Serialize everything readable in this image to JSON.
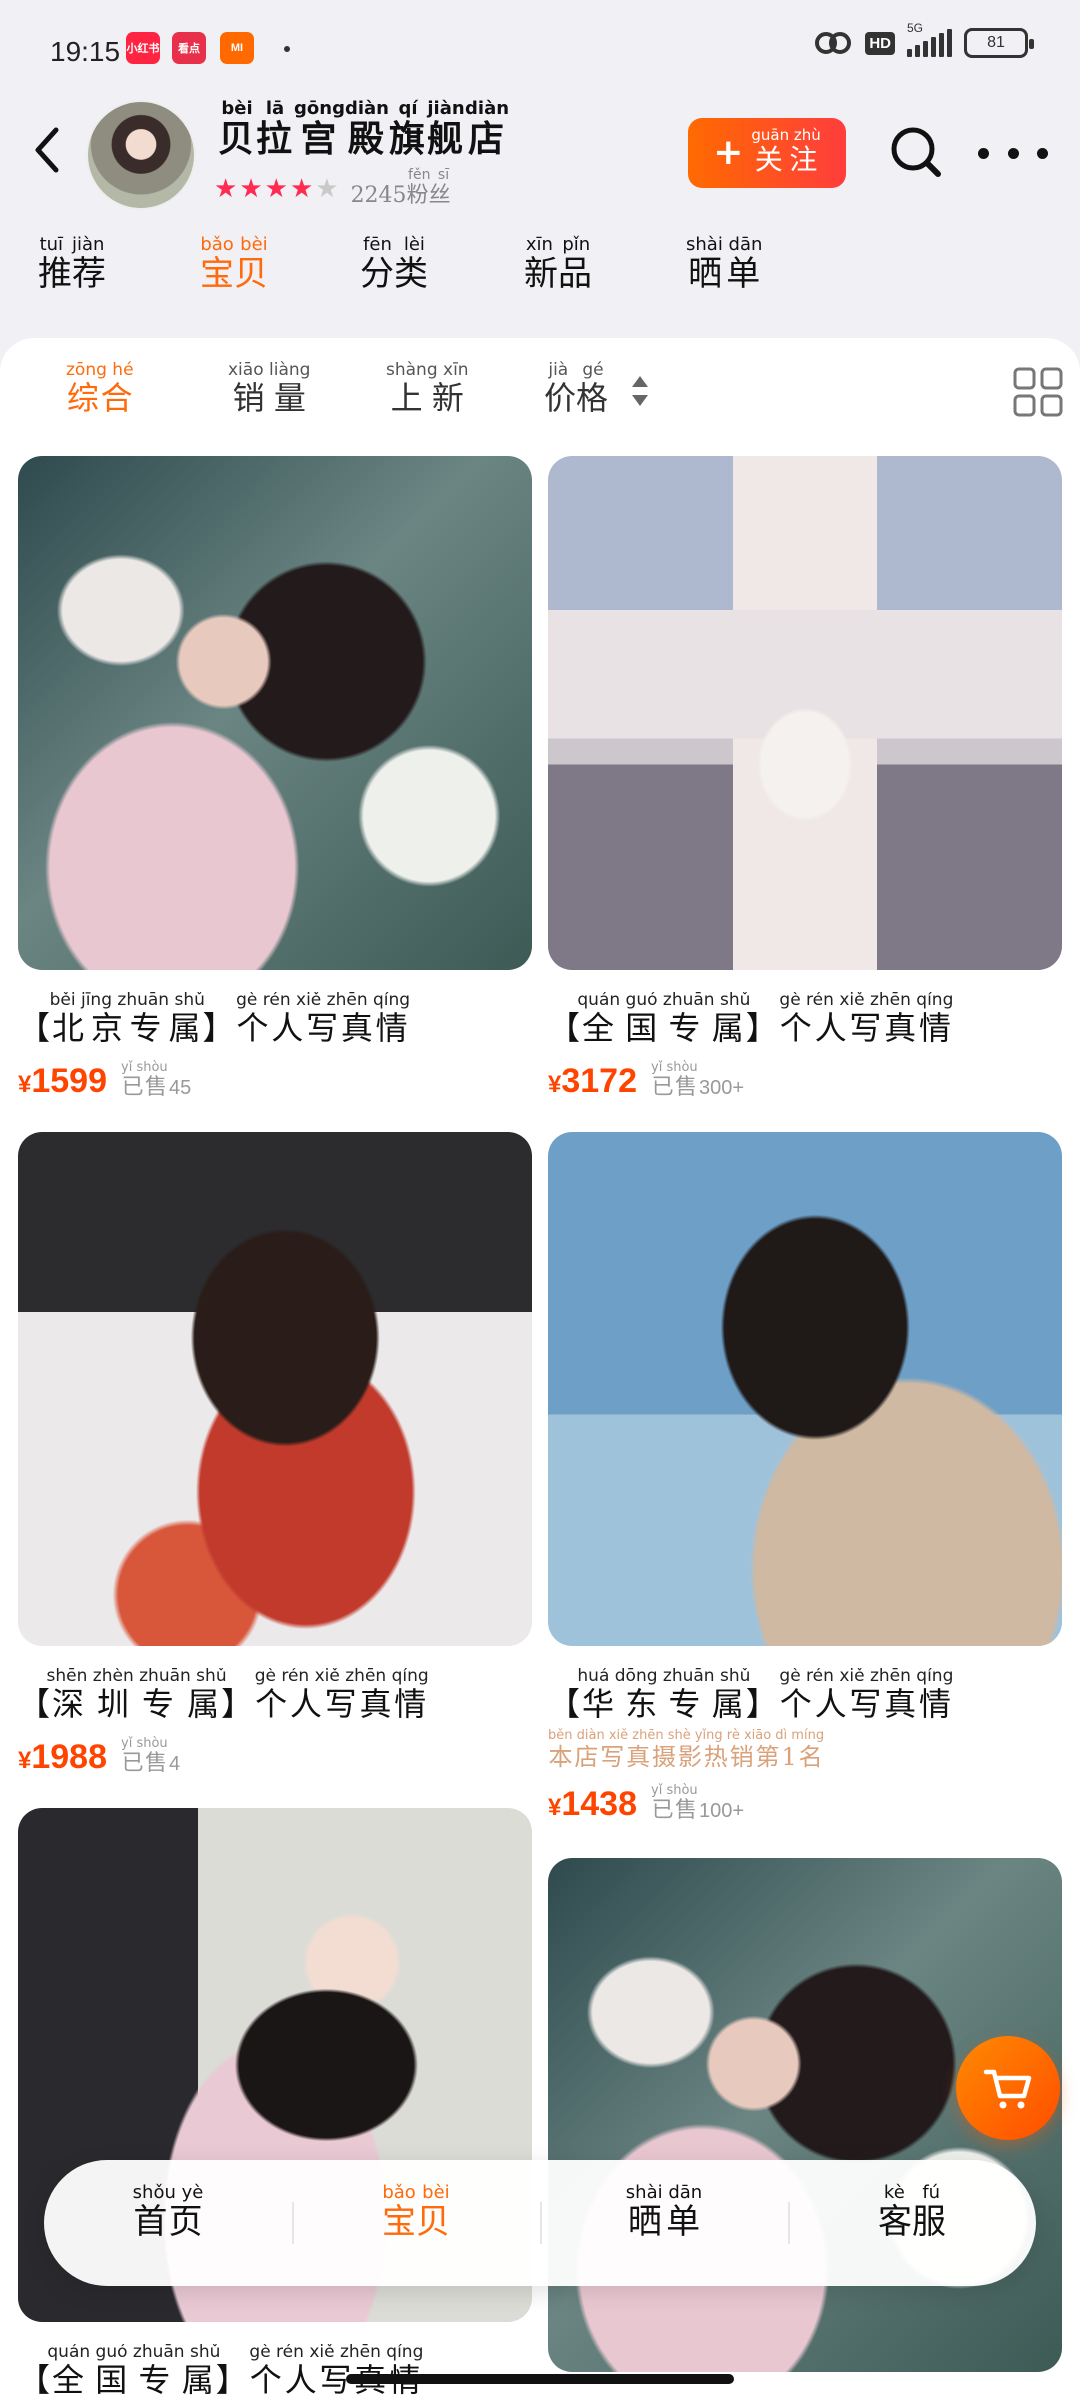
{
  "status": {
    "time": "19:15",
    "apps": [
      {
        "name": "xiaohongshu-icon",
        "label": "小红书",
        "color": "#ff2442"
      },
      {
        "name": "app-icon",
        "label": "看点",
        "color": "#e8304a"
      },
      {
        "name": "mi-icon",
        "label": "MI",
        "color": "#ff6900"
      }
    ],
    "hd": "HD",
    "network": "5G",
    "battery": "81"
  },
  "shop": {
    "name_chars": [
      {
        "c": "贝",
        "p": "bèi"
      },
      {
        "c": "拉",
        "p": "lā"
      },
      {
        "c": "宫",
        "p": "gōng"
      },
      {
        "c": "殿",
        "p": "diàn"
      },
      {
        "c": "旗",
        "p": "qí"
      },
      {
        "c": "舰",
        "p": "jiàn"
      },
      {
        "c": "店",
        "p": "diàn"
      }
    ],
    "rating_stars": 4,
    "rating_max": 5,
    "fans_count": "2245",
    "fans_label": {
      "c": "粉丝",
      "p": "fěn sī"
    },
    "follow_label": {
      "c": "关注",
      "p": "guān zhù"
    },
    "accent": "#ff6a0c"
  },
  "shop_tabs": [
    {
      "label": "推荐",
      "pinyin": "tuī jiàn",
      "active": false
    },
    {
      "label": "宝贝",
      "pinyin": "bǎo bèi",
      "active": true
    },
    {
      "label": "分类",
      "pinyin": "fēn lèi",
      "active": false
    },
    {
      "label": "新品",
      "pinyin": "xīn pǐn",
      "active": false
    },
    {
      "label": "晒单",
      "pinyin": "shài dān",
      "active": false
    }
  ],
  "sort_options": [
    {
      "label": "综合",
      "pinyin": "zōng hé",
      "active": true
    },
    {
      "label": "销量",
      "pinyin": "xiāo liàng",
      "active": false
    },
    {
      "label": "上新",
      "pinyin": "shàng xīn",
      "active": false
    },
    {
      "label": "价格",
      "pinyin": "jià gé",
      "active": false
    }
  ],
  "sold_label": {
    "c": "已售",
    "p": "yǐ shòu"
  },
  "currency": "¥",
  "products": [
    {
      "title": [
        {
          "c": "【",
          "p": ""
        },
        {
          "c": "北京专属",
          "p": "běi jīng zhuān shǔ"
        },
        {
          "c": "】",
          "p": ""
        },
        {
          "c": "个人写真情",
          "p": "gè rén xiě zhēn qíng"
        }
      ],
      "price": "1599",
      "sold": "45",
      "rank": null,
      "scene": "a"
    },
    {
      "title": [
        {
          "c": "【",
          "p": ""
        },
        {
          "c": "全国专属",
          "p": "quán guó zhuān shǔ"
        },
        {
          "c": "】",
          "p": ""
        },
        {
          "c": "个人写真情",
          "p": "gè rén xiě zhēn qíng"
        }
      ],
      "price": "3172",
      "sold": "300+",
      "rank": null,
      "scene": "b"
    },
    {
      "title": [
        {
          "c": "【",
          "p": ""
        },
        {
          "c": "深圳专属",
          "p": "shēn zhèn zhuān shǔ"
        },
        {
          "c": "】",
          "p": ""
        },
        {
          "c": "个人写真情",
          "p": "gè rén xiě zhēn qíng"
        }
      ],
      "price": "1988",
      "sold": "4",
      "rank": null,
      "scene": "c"
    },
    {
      "title": [
        {
          "c": "【",
          "p": ""
        },
        {
          "c": "华东专属",
          "p": "huá dōng zhuān shǔ"
        },
        {
          "c": "】",
          "p": ""
        },
        {
          "c": "个人写真情",
          "p": "gè rén xiě zhēn qíng"
        }
      ],
      "price": "1438",
      "sold": "100+",
      "rank": {
        "c": "本店写真摄影热销第1名",
        "p": "běn diàn xiě zhēn shè yǐng rè xiāo dì míng"
      },
      "scene": "d"
    },
    {
      "title": [
        {
          "c": "【",
          "p": ""
        },
        {
          "c": "全国专属",
          "p": "quán guó zhuān shǔ"
        },
        {
          "c": "】",
          "p": ""
        },
        {
          "c": "个人写真情",
          "p": "gè rén xiě zhēn qíng"
        }
      ],
      "price": "",
      "sold": "",
      "rank": null,
      "scene": "e"
    },
    {
      "title": [],
      "price": "",
      "sold": "",
      "rank": null,
      "scene": "a"
    }
  ],
  "bottom_nav": [
    {
      "label": "首页",
      "pinyin": "shǒu yè",
      "active": false
    },
    {
      "label": "宝贝",
      "pinyin": "bǎo bèi",
      "active": true
    },
    {
      "label": "晒单",
      "pinyin": "shài dān",
      "active": false
    },
    {
      "label": "客服",
      "pinyin": "kè fú",
      "active": false
    }
  ]
}
